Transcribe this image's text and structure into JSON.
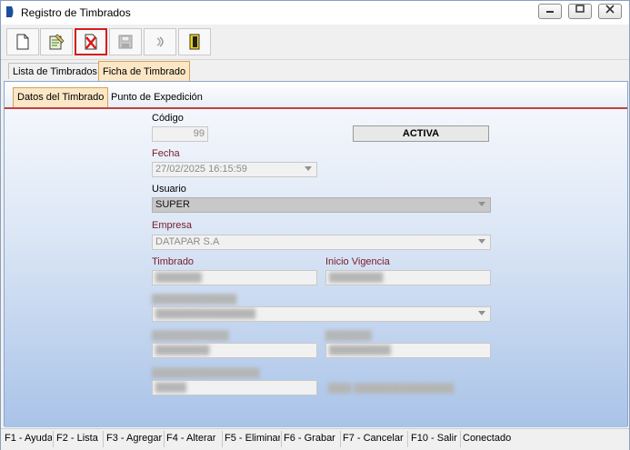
{
  "window": {
    "title": "Registro de Timbrados"
  },
  "toolbar": {
    "buttons": [
      {
        "name": "new-document-icon"
      },
      {
        "name": "edit-document-icon"
      },
      {
        "name": "delete-icon"
      },
      {
        "name": "save-icon"
      },
      {
        "name": "undo-icon"
      },
      {
        "name": "exit-icon"
      }
    ]
  },
  "tabs": [
    "Lista de Timbrados",
    "Ficha de Timbrado"
  ],
  "subtabs": [
    "Datos del Timbrado",
    "Punto de Expedición"
  ],
  "form": {
    "codigo_label": "Código",
    "codigo_value": "99",
    "status_value": "ACTIVA",
    "fecha_label": "Fecha",
    "fecha_value": "27/02/2025 16:15:59",
    "usuario_label": "Usuario",
    "usuario_value": "SUPER",
    "empresa_label": "Empresa",
    "empresa_value": "DATAPAR S.A",
    "timbrado_label": "Timbrado",
    "inicio_vigencia_label": "Inicio Vigencia"
  },
  "statusbar": {
    "items": [
      "F1 - Ayuda",
      "F2 - Lista",
      "F3 - Agregar",
      "F4 - Alterar",
      "F5 - Eliminar",
      "F6 - Grabar",
      "F7 - Cancelar",
      "F10 - Salir"
    ],
    "connection": "Conectado"
  },
  "colors": {
    "label_red": "#7a1a2a",
    "highlight_border": "#d21e1e",
    "active_tab": "#fbe7c5"
  }
}
